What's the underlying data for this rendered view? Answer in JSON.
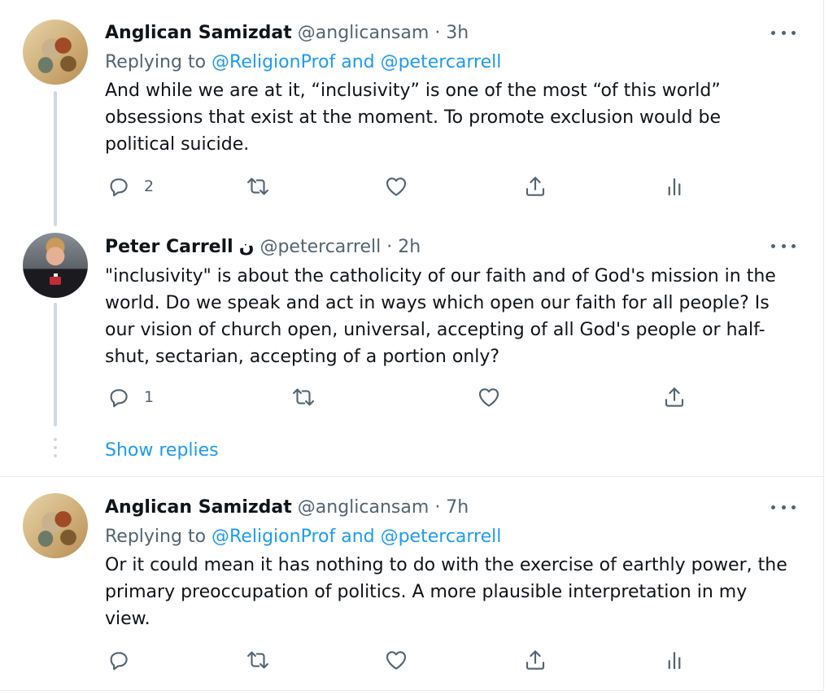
{
  "tweets": [
    {
      "name": "Anglican Samizdat",
      "handle": "@anglicansam",
      "time": "· 3h",
      "replying_prefix": "Replying to",
      "replying_to": "@ReligionProf and @petercarrell",
      "text": "And while we are at it, “inclusivity” is one of the most “of this world” obsessions that exist at the moment. To promote exclusion would be political suicide.",
      "reply_count": "2"
    },
    {
      "name": "Peter Carrell",
      "name_badge": "ن",
      "handle": "@petercarrell",
      "time": "· 2h",
      "text": "\"inclusivity\" is about the catholicity of our faith and of God's mission in the world. Do we speak and act in ways which open our faith for all people? Is our vision of church open, universal, accepting of all God's people or half-shut, sectarian, accepting of a portion only?",
      "reply_count": "1"
    },
    {
      "name": "Anglican Samizdat",
      "handle": "@anglicansam",
      "time": "· 7h",
      "replying_prefix": "Replying to",
      "replying_to": "@ReligionProf and @petercarrell",
      "text": "Or it could mean it has nothing to do with the exercise of earthly power, the primary preoccupation of politics. A more plausible interpretation in my view."
    }
  ],
  "show_replies": "Show replies",
  "icons": {
    "reply": "reply-icon",
    "retweet": "retweet-icon",
    "like": "heart-icon",
    "share": "share-icon",
    "analytics": "analytics-icon",
    "more": "more-icon"
  },
  "colors": {
    "text": "#0f1419",
    "secondary": "#536471",
    "link": "#1d9bf0",
    "thread_line": "#cfd9de"
  }
}
